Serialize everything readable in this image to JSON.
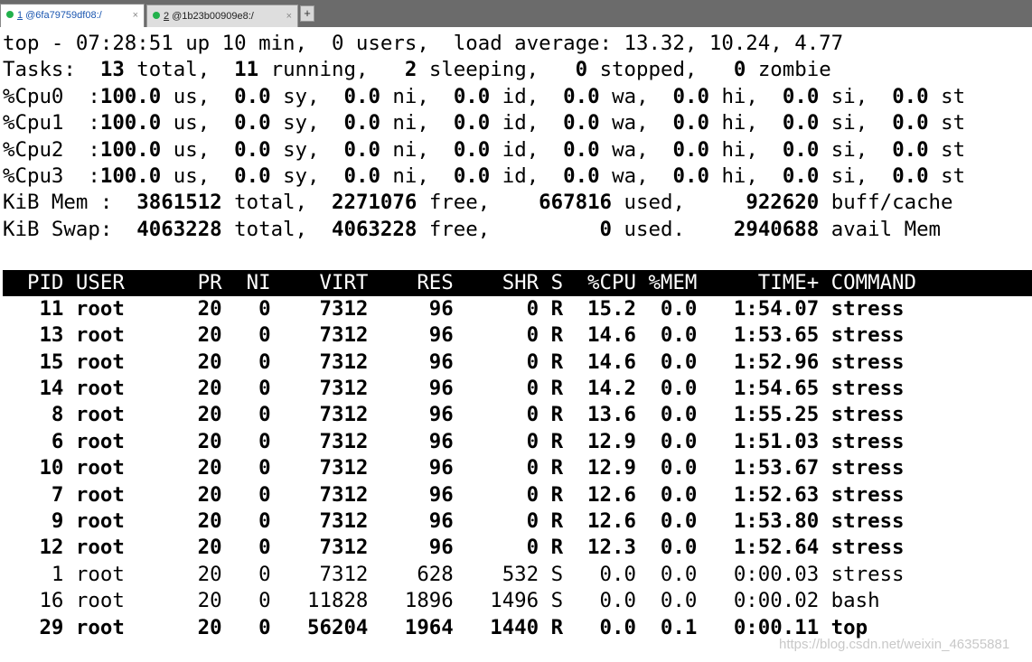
{
  "tabs": [
    {
      "number": "1",
      "label": "@6fa79759df08:/",
      "close": "×"
    },
    {
      "number": "2",
      "label": "@1b23b00909e8:/",
      "close": "×"
    }
  ],
  "new_tab_label": "+",
  "summary": {
    "top_line": "top - 07:28:51 up 10 min,  0 users,  load average: 13.32, 10.24, 4.77",
    "tasks": {
      "label": "Tasks:",
      "total": "13",
      "running": "11",
      "sleeping": "2",
      "stopped": "0",
      "zombie": "0"
    },
    "cpus": [
      {
        "label": "%Cpu0",
        "us": "100.0",
        "sy": "0.0",
        "ni": "0.0",
        "id": "0.0",
        "wa": "0.0",
        "hi": "0.0",
        "si": "0.0",
        "st": "0.0"
      },
      {
        "label": "%Cpu1",
        "us": "100.0",
        "sy": "0.0",
        "ni": "0.0",
        "id": "0.0",
        "wa": "0.0",
        "hi": "0.0",
        "si": "0.0",
        "st": "0.0"
      },
      {
        "label": "%Cpu2",
        "us": "100.0",
        "sy": "0.0",
        "ni": "0.0",
        "id": "0.0",
        "wa": "0.0",
        "hi": "0.0",
        "si": "0.0",
        "st": "0.0"
      },
      {
        "label": "%Cpu3",
        "us": "100.0",
        "sy": "0.0",
        "ni": "0.0",
        "id": "0.0",
        "wa": "0.0",
        "hi": "0.0",
        "si": "0.0",
        "st": "0.0"
      }
    ],
    "mem": {
      "label": "KiB Mem :",
      "total": "3861512",
      "free": "2271076",
      "used": "667816",
      "buff_cache": "922620"
    },
    "swap": {
      "label": "KiB Swap:",
      "total": "4063228",
      "free": "4063228",
      "used": "0",
      "avail_mem": "2940688"
    }
  },
  "process_table": {
    "columns": [
      "PID",
      "USER",
      "PR",
      "NI",
      "VIRT",
      "RES",
      "SHR",
      "S",
      "%CPU",
      "%MEM",
      "TIME+",
      "COMMAND"
    ],
    "rows": [
      {
        "pid": "11",
        "user": "root",
        "pr": "20",
        "ni": "0",
        "virt": "7312",
        "res": "96",
        "shr": "0",
        "s": "R",
        "cpu": "15.2",
        "mem": "0.0",
        "time": "1:54.07",
        "command": "stress",
        "highlight": true
      },
      {
        "pid": "13",
        "user": "root",
        "pr": "20",
        "ni": "0",
        "virt": "7312",
        "res": "96",
        "shr": "0",
        "s": "R",
        "cpu": "14.6",
        "mem": "0.0",
        "time": "1:53.65",
        "command": "stress",
        "highlight": true
      },
      {
        "pid": "15",
        "user": "root",
        "pr": "20",
        "ni": "0",
        "virt": "7312",
        "res": "96",
        "shr": "0",
        "s": "R",
        "cpu": "14.6",
        "mem": "0.0",
        "time": "1:52.96",
        "command": "stress",
        "highlight": true
      },
      {
        "pid": "14",
        "user": "root",
        "pr": "20",
        "ni": "0",
        "virt": "7312",
        "res": "96",
        "shr": "0",
        "s": "R",
        "cpu": "14.2",
        "mem": "0.0",
        "time": "1:54.65",
        "command": "stress",
        "highlight": true
      },
      {
        "pid": "8",
        "user": "root",
        "pr": "20",
        "ni": "0",
        "virt": "7312",
        "res": "96",
        "shr": "0",
        "s": "R",
        "cpu": "13.6",
        "mem": "0.0",
        "time": "1:55.25",
        "command": "stress",
        "highlight": true
      },
      {
        "pid": "6",
        "user": "root",
        "pr": "20",
        "ni": "0",
        "virt": "7312",
        "res": "96",
        "shr": "0",
        "s": "R",
        "cpu": "12.9",
        "mem": "0.0",
        "time": "1:51.03",
        "command": "stress",
        "highlight": true
      },
      {
        "pid": "10",
        "user": "root",
        "pr": "20",
        "ni": "0",
        "virt": "7312",
        "res": "96",
        "shr": "0",
        "s": "R",
        "cpu": "12.9",
        "mem": "0.0",
        "time": "1:53.67",
        "command": "stress",
        "highlight": true
      },
      {
        "pid": "7",
        "user": "root",
        "pr": "20",
        "ni": "0",
        "virt": "7312",
        "res": "96",
        "shr": "0",
        "s": "R",
        "cpu": "12.6",
        "mem": "0.0",
        "time": "1:52.63",
        "command": "stress",
        "highlight": true
      },
      {
        "pid": "9",
        "user": "root",
        "pr": "20",
        "ni": "0",
        "virt": "7312",
        "res": "96",
        "shr": "0",
        "s": "R",
        "cpu": "12.6",
        "mem": "0.0",
        "time": "1:53.80",
        "command": "stress",
        "highlight": true
      },
      {
        "pid": "12",
        "user": "root",
        "pr": "20",
        "ni": "0",
        "virt": "7312",
        "res": "96",
        "shr": "0",
        "s": "R",
        "cpu": "12.3",
        "mem": "0.0",
        "time": "1:52.64",
        "command": "stress",
        "highlight": true
      },
      {
        "pid": "1",
        "user": "root",
        "pr": "20",
        "ni": "0",
        "virt": "7312",
        "res": "628",
        "shr": "532",
        "s": "S",
        "cpu": "0.0",
        "mem": "0.0",
        "time": "0:00.03",
        "command": "stress",
        "highlight": false
      },
      {
        "pid": "16",
        "user": "root",
        "pr": "20",
        "ni": "0",
        "virt": "11828",
        "res": "1896",
        "shr": "1496",
        "s": "S",
        "cpu": "0.0",
        "mem": "0.0",
        "time": "0:00.02",
        "command": "bash",
        "highlight": false
      },
      {
        "pid": "29",
        "user": "root",
        "pr": "20",
        "ni": "0",
        "virt": "56204",
        "res": "1964",
        "shr": "1440",
        "s": "R",
        "cpu": "0.0",
        "mem": "0.1",
        "time": "0:00.11",
        "command": "top",
        "highlight": true
      }
    ]
  },
  "watermark": "https://blog.csdn.net/weixin_46355881"
}
